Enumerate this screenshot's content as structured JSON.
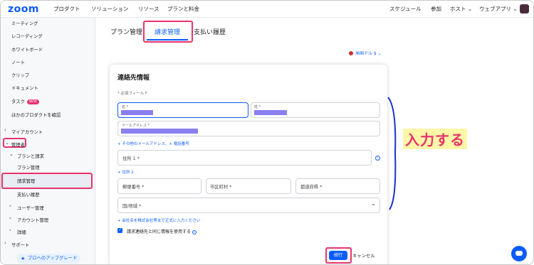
{
  "topbar": {
    "logo": "zoom",
    "nav": [
      "プロダクト",
      "ソリューション",
      "リソース",
      "プランと料金"
    ],
    "right": [
      "スケジュール",
      "参加",
      "ホスト",
      "ウェブアプリ"
    ]
  },
  "sidebar": {
    "items": {
      "meeting": "ミーティング",
      "recording": "レコーディング",
      "whiteboard": "ホワイトボード",
      "notes": "ノート",
      "clips": "クリップ",
      "docs": "ドキュメント",
      "tasks": "タスク",
      "tasks_badge": "NEW",
      "other_products": "ほかのプロダクトを確認",
      "my_account": "マイアカウント",
      "admin": "管理者",
      "plans_billing": "プランと請求",
      "plan_mgmt": "プラン管理",
      "billing_mgmt": "請求管理",
      "payment_history": "支払い履歴",
      "user_mgmt": "ユーザー管理",
      "account_mgmt": "アカウント管理",
      "details": "詳細",
      "support": "サポート"
    },
    "upgrade": "プロへのアップグレード"
  },
  "tabs": [
    "プラン管理",
    "請求管理",
    "支払い履歴"
  ],
  "currency": "米国ドル $",
  "form": {
    "title": "連絡先情報",
    "required_note": "* 必須フィールド",
    "first_name_label": "名 *",
    "last_name_label": "姓 *",
    "email_label": "メールアドレス *",
    "add_links": "+ その他のメールアドレス、+ 電話番号",
    "address1": "住所 1 *",
    "address2_link": "+ 住所 2",
    "zip": "郵便番号 *",
    "city": "市区町村 *",
    "state": "都道府県 *",
    "country": "国/地域 *",
    "company_link": "+ 会社名を株式会社等まで正式に入力ください",
    "checkbox_label": "請求連絡先と同じ情報を使用する",
    "continue": "続行",
    "cancel": "キャンセル"
  },
  "annotation": "入力する",
  "colors": {
    "accent": "#0b5cff",
    "highlight": "#e8336d",
    "redaction": "#8a7ff0"
  }
}
